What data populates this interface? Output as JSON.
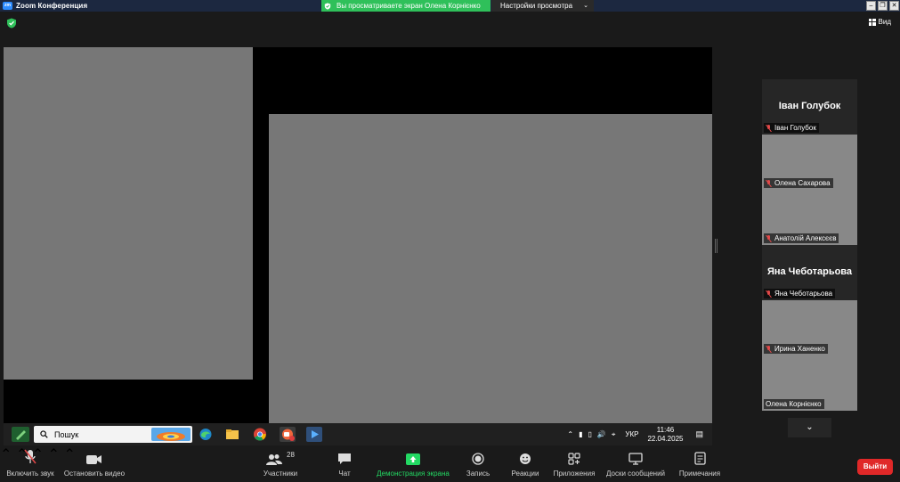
{
  "window": {
    "app_title": "Zoom Конференция",
    "share_banner": "Вы просматриваете экран Олена Корнієнко",
    "view_options_label": "Настройки просмотра",
    "view_button": "Вид"
  },
  "taskbar": {
    "search_text": "Пошук",
    "language": "УКР",
    "time": "11:46",
    "date": "22.04.2025"
  },
  "participants": [
    {
      "type": "name-only",
      "display_name": "Іван Голубок",
      "label": "Іван Голубок",
      "muted": true
    },
    {
      "type": "video",
      "label": "Олена Сахарова",
      "muted": true
    },
    {
      "type": "video",
      "label": "Анатолій Алексєєв",
      "muted": true
    },
    {
      "type": "name-only",
      "display_name": "Яна Чеботарьова",
      "label": "Яна Чеботарьова",
      "muted": true
    },
    {
      "type": "video",
      "label": "Ирина Ханенко",
      "muted": true
    },
    {
      "type": "video",
      "label": "Олена Корнієнко",
      "muted": false,
      "active_speaker": true
    }
  ],
  "toolbar": {
    "mute": "Включить звук",
    "video": "Остановить видео",
    "participants": "Участники",
    "participants_count": "28",
    "chat": "Чат",
    "share": "Демонстрация экрана",
    "record": "Запись",
    "reactions": "Реакции",
    "apps": "Приложения",
    "whiteboards": "Доски сообщений",
    "notes": "Примечания",
    "leave": "Выйти"
  },
  "colors": {
    "share_green": "#2fc05a",
    "leave_red": "#e02828",
    "active_speaker_outline": "#c8e04b",
    "muted_red": "#e04848"
  }
}
